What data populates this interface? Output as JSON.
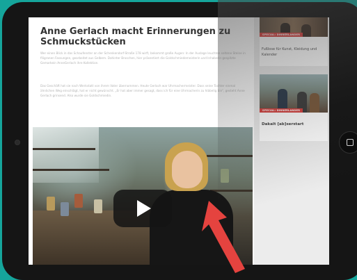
{
  "article": {
    "title": "Anne Gerlach macht Erinnerungen zu Schmuckstücken",
    "paragraph1": "Wer einen Blick in das Schaufenster an der Schenkendorf-Straße 178 wirft, bekommt große Augen: In der Auslage leuchten seltene Steine in filigranen Fassungen, gearbeitet aus Gelbem. Dahinter Broschen, hier präsentiert die Goldschmiedemeisterin und Inhaberin gespitzte Gemarkein AnneGerlach ihre Kollektion.",
    "paragraph2": "Das Geschäft hat sie nach Werkstatt von ihrem Vater übernommen. Heute Gerlach war Uhrmachermeister. Dass seine Tochter einmal ähnlichen Weg einschlägt, hat er nicht gewünscht. „Er hat aber immer gesagt, dass ich für eine Uhrmacherin zu hibbelig bin“, gesteht Anne Gerlach grinsend. Also wurde sie Goldschmiedin."
  },
  "video": {
    "play_label": "play"
  },
  "sidebar": {
    "cards": [
      {
        "tag": "SPECIAL: DINNERLANDER",
        "text": "Fußlose für Kunst, Kleidung und Kalender"
      },
      {
        "tag": "SPECIAL: DINNERLANDER",
        "text": "Dakalt [ab]serstart"
      }
    ]
  },
  "colors": {
    "background": "#15a59b",
    "tag_red": "#d6413f",
    "arrow_red": "#e5433f",
    "bezel": "#151515"
  },
  "icons": {
    "play": "play-icon",
    "home": "home-button-icon",
    "arrow": "red-arrow-icon"
  }
}
